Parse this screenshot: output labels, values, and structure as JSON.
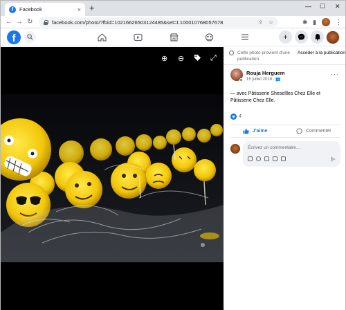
{
  "browser": {
    "tab_title": "Facebook",
    "tab_close": "×",
    "new_tab": "+",
    "url": "facebook.com/photo/?fbid=1021662650312448​5&set=t.100010768057678",
    "win_minimize": "—",
    "win_maximize": "☐",
    "win_close": "✕"
  },
  "icons": {
    "back": "←",
    "forward": "→",
    "reload": "↻",
    "share": "⇪",
    "star": "☆",
    "extensions": "✱",
    "sidebar": "▮",
    "menu": "⋮",
    "fb_search": "⚲",
    "home": "⌂",
    "watch": "▷",
    "marketplace": "⌹",
    "groups": "☺",
    "menu_lines": "≡",
    "create": "+",
    "messenger": "✉",
    "notifications": "🔔",
    "zoom_in": "⊕",
    "zoom_out": "⊖",
    "tag": "🏷",
    "fullscreen": "⤢"
  },
  "viewer": {
    "accent_color": "#1877f2"
  },
  "side": {
    "notice_text": "Cette photo provient d'une publication.",
    "notice_link": "Accéder à la publication",
    "poster_name": "Rouja Herguem",
    "post_date": "15 juillet 2018 · 👥",
    "post_text": "— avec Pâtisserie Shesellles Chez Elle et Pâtisserie Chez Elle.",
    "like_count": "4",
    "like_label": "J'aime",
    "comment_label": "Commenter",
    "comment_placeholder": "Écrivez un commentaire…",
    "more": "···"
  }
}
